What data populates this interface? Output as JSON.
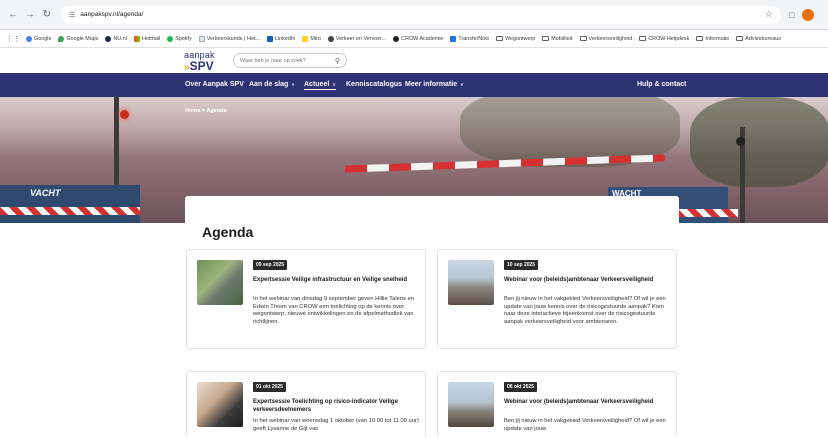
{
  "browser": {
    "url": "aanpakspv.nl/agenda/",
    "bookmarks": [
      "Google",
      "Google Maps",
      "NU.nl",
      "Hotmail",
      "Spotify",
      "Verkeerskunde | Het...",
      "LinkedIn",
      "Miro",
      "Verkeer en Vervoer...",
      "CROW Academie",
      "TransferNow",
      "Wegontwerp",
      "Mobiliteit",
      "Verkeersveiligheid",
      "CROW Helpdesk",
      "Informatie",
      "Adviesbureaus"
    ],
    "colors": {
      "profile": "#e8710a"
    }
  },
  "site": {
    "logo_top": "aanpak",
    "logo_bottom": "SPV",
    "search_placeholder": "Waar ben je naar op zoek?",
    "nav": {
      "over": "Over Aanpak SPV",
      "aan_de_slag": "Aan de slag",
      "actueel": "Actueel",
      "kennis": "Kenniscatalogus",
      "meer": "Meer informatie",
      "hulp": "Hulp & contact"
    },
    "breadcrumb": "Home > Agenda",
    "hero_sign_left": "VACHT",
    "hero_sign_right": "WACHT",
    "colors": {
      "nav_bg": "#2d3272",
      "accent": "#f3a31b",
      "barrier_red": "#d63030"
    }
  },
  "page": {
    "title": "Agenda",
    "events": [
      {
        "date": "09 sep 2025",
        "title": "Expertsessie Veilige infrastructuur en Veilige snelheid",
        "desc": "In het webinar van dinsdag 9 september geven Hillie Talens en Edwin Thoen van CROW een toelichting op de kennis over wegontwerp, nieuwe ontwikkelingen en de afpelmethodiek van richtlijnen."
      },
      {
        "date": "10 sep 2025",
        "title": "Webinar voor (beleids)ambtenaar Verkeersveiligheid",
        "desc": "Ben jij nieuw in het vakgebied Verkeersveiligheid? Of wil je een update van jouw kennis over de risicogestuurde aanpak? Kom naar deze interactieve bijeenkomst over de risicogestuurde aanpak verkeersveiligheid voor ambtenaren."
      },
      {
        "date": "01 okt 2025",
        "title": "Expertsessie Toelichting op risico-indicator Veilige verkeersdeelnemers",
        "desc": "In het webinar van woensdag 1 oktober (van 10.00 tot 11.00 uur) geeft Lysanne de Gijt van"
      },
      {
        "date": "08 okt 2025",
        "title": "Webinar voor (beleids)ambtenaar Verkeersveiligheid",
        "desc": "Ben jij nieuw in het vakgebied Verkeersveiligheid? Of wil je een update van jouw"
      }
    ]
  }
}
